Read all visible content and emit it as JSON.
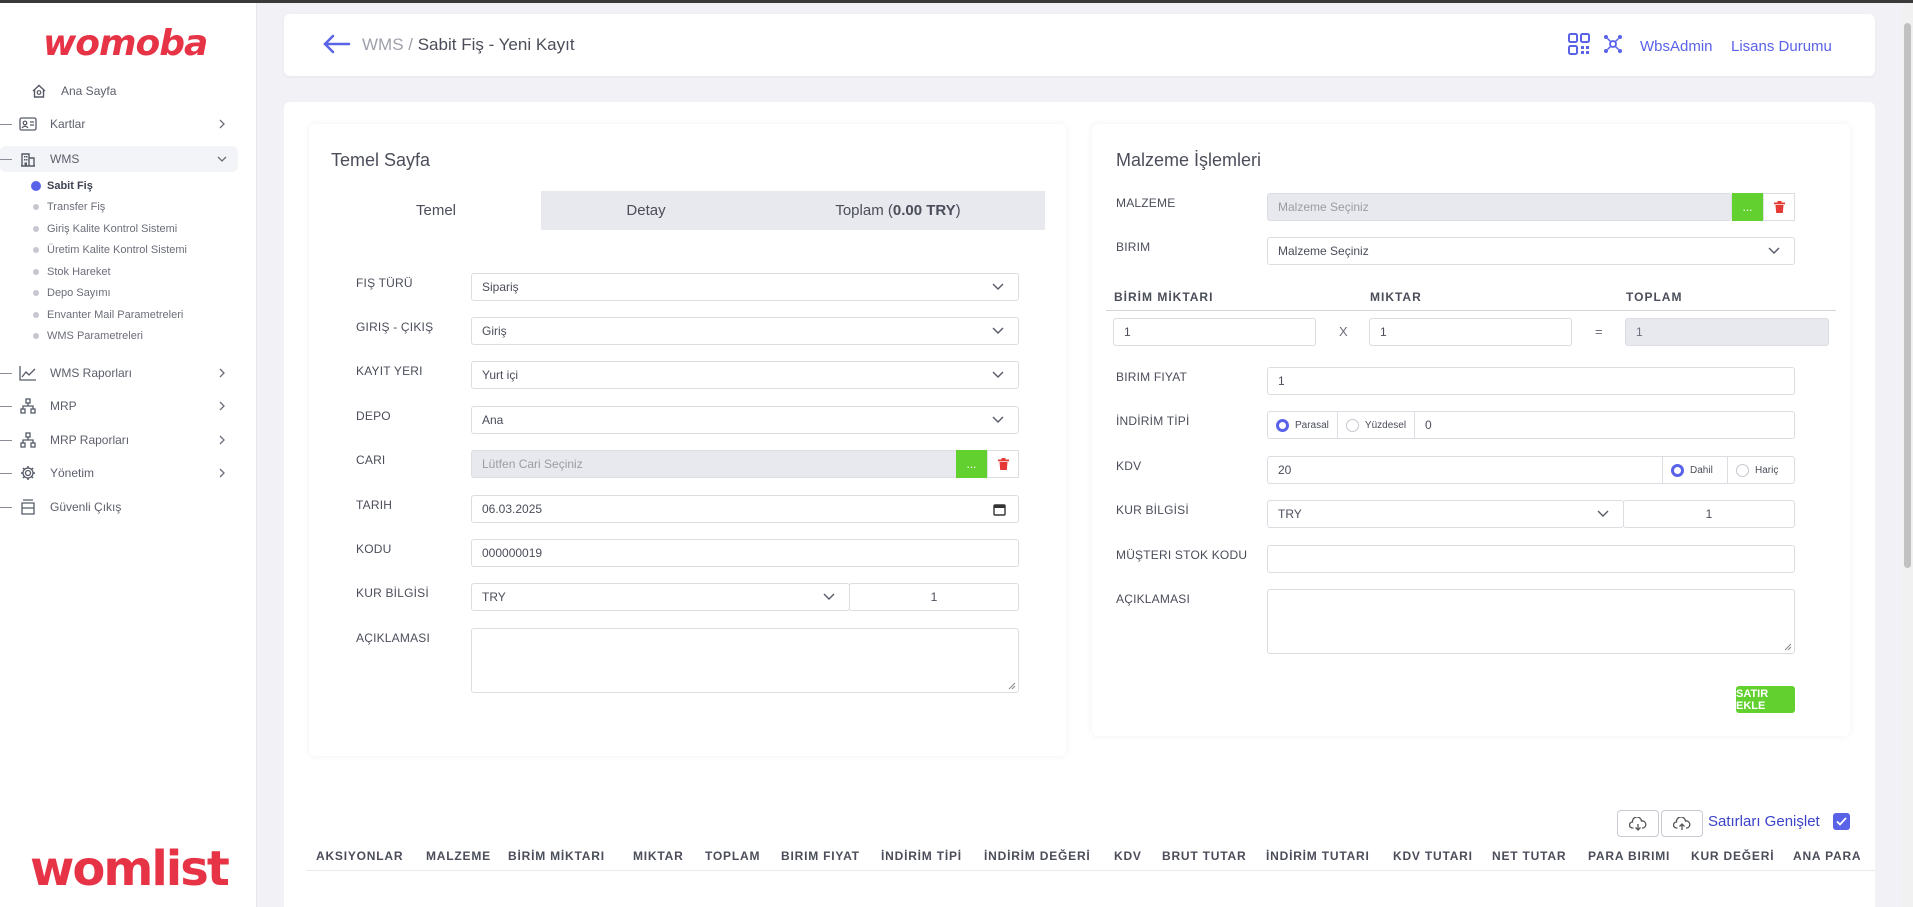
{
  "brand": {
    "top_logo": "womoba",
    "bottom_logo": "womlist",
    "color": "#e63346"
  },
  "sidebar": {
    "items": [
      {
        "label": "Ana Sayfa",
        "icon": "home-icon"
      },
      {
        "label": "Kartlar",
        "icon": "id-card-icon"
      },
      {
        "label": "WMS",
        "icon": "building-icon"
      },
      {
        "label": "WMS Raporları",
        "icon": "chart-line-icon"
      },
      {
        "label": "MRP",
        "icon": "sitemap-icon"
      },
      {
        "label": "MRP Raporları",
        "icon": "sitemap-icon"
      },
      {
        "label": "Yönetim",
        "icon": "gear-icon"
      },
      {
        "label": "Güvenli Çıkış",
        "icon": "logout-icon"
      }
    ],
    "wms_sub": [
      "Sabit Fiş",
      "Transfer Fiş",
      "Giriş Kalite Kontrol Sistemi",
      "Üretim Kalite Kontrol Sistemi",
      "Stok Hareket",
      "Depo Sayımı",
      "Envanter Mail Parametreleri",
      "WMS Parametreleri"
    ]
  },
  "header": {
    "crumb_parent": "WMS",
    "crumb_sep": " / ",
    "crumb_current": "Sabit Fiş - Yeni Kayıt",
    "user": "WbsAdmin",
    "license": "Lisans Durumu"
  },
  "left_panel": {
    "title": "Temel Sayfa",
    "tabs": {
      "temel": "Temel",
      "detay": "Detay",
      "toplam_prefix": "Toplam (",
      "toplam_value": "0.00 TRY",
      "toplam_suffix": ")"
    },
    "labels": {
      "fis_turu": "FIŞ TÜRÜ",
      "giris_cikis": "GIRIŞ - ÇIKIŞ",
      "kayit_yeri": "KAYIT YERI",
      "depo": "DEPO",
      "cari": "CARI",
      "tarih": "TARIH",
      "kodu": "KODU",
      "kur": "KUR BİLGİSİ",
      "aciklama": "AÇIKLAMASI"
    },
    "values": {
      "fis_turu": "Sipariş",
      "giris_cikis": "Giriş",
      "kayit_yeri": "Yurt içi",
      "depo": "Ana",
      "cari_placeholder": "Lütfen Cari Seçiniz",
      "tarih": "06.03.2025",
      "kodu": "000000019",
      "kur": "TRY",
      "kur_value": "1",
      "aciklama": ""
    },
    "select_button": "..."
  },
  "right_panel": {
    "title": "Malzeme İşlemleri",
    "labels": {
      "malzeme": "MALZEME",
      "birim": "BIRIM",
      "birim_fiyat": "BIRIM FIYAT",
      "indirim_tipi": "İNDİRİM TİPİ",
      "kdv": "KDV",
      "kur": "KUR BİLGİSİ",
      "musteri_stok": "MÜŞTERI STOK KODU",
      "aciklama": "AÇIKLAMASI"
    },
    "cols": {
      "birim_miktari": "BİRİM MİKTARI",
      "miktar": "MIKTAR",
      "toplam": "TOPLAM"
    },
    "values": {
      "malzeme_placeholder": "Malzeme Seçiniz",
      "birim": "Malzeme Seçiniz",
      "birim_miktari": "1",
      "miktar": "1",
      "toplam": "1",
      "birim_fiyat": "1",
      "indirim_value": "0",
      "kdv": "20",
      "kur": "TRY",
      "kur_value": "1",
      "musteri_stok": "",
      "aciklama": ""
    },
    "ops": {
      "x": "X",
      "eq": "="
    },
    "radios": {
      "parasal": "Parasal",
      "yuzdesel": "Yüzdesel",
      "dahil": "Dahil",
      "haric": "Hariç"
    },
    "add_button": "SATIR EKLE",
    "select_button": "..."
  },
  "table": {
    "expand_label": "Satırları Genişlet",
    "headers": [
      "AKSIYONLAR",
      "MALZEME",
      "BİRİM MİKTARI",
      "MIKTAR",
      "TOPLAM",
      "BIRIM FIYAT",
      "İNDİRİM TİPİ",
      "İNDİRİM DEĞERİ",
      "KDV",
      "BRUT TUTAR",
      "İNDİRİM TUTARI",
      "KDV TUTARI",
      "NET TUTAR",
      "PARA BIRIMI",
      "KUR DEĞERİ",
      "ANA PARA"
    ]
  },
  "colors": {
    "accent": "#5a62e8",
    "green": "#62d12f",
    "danger": "#e53935"
  }
}
